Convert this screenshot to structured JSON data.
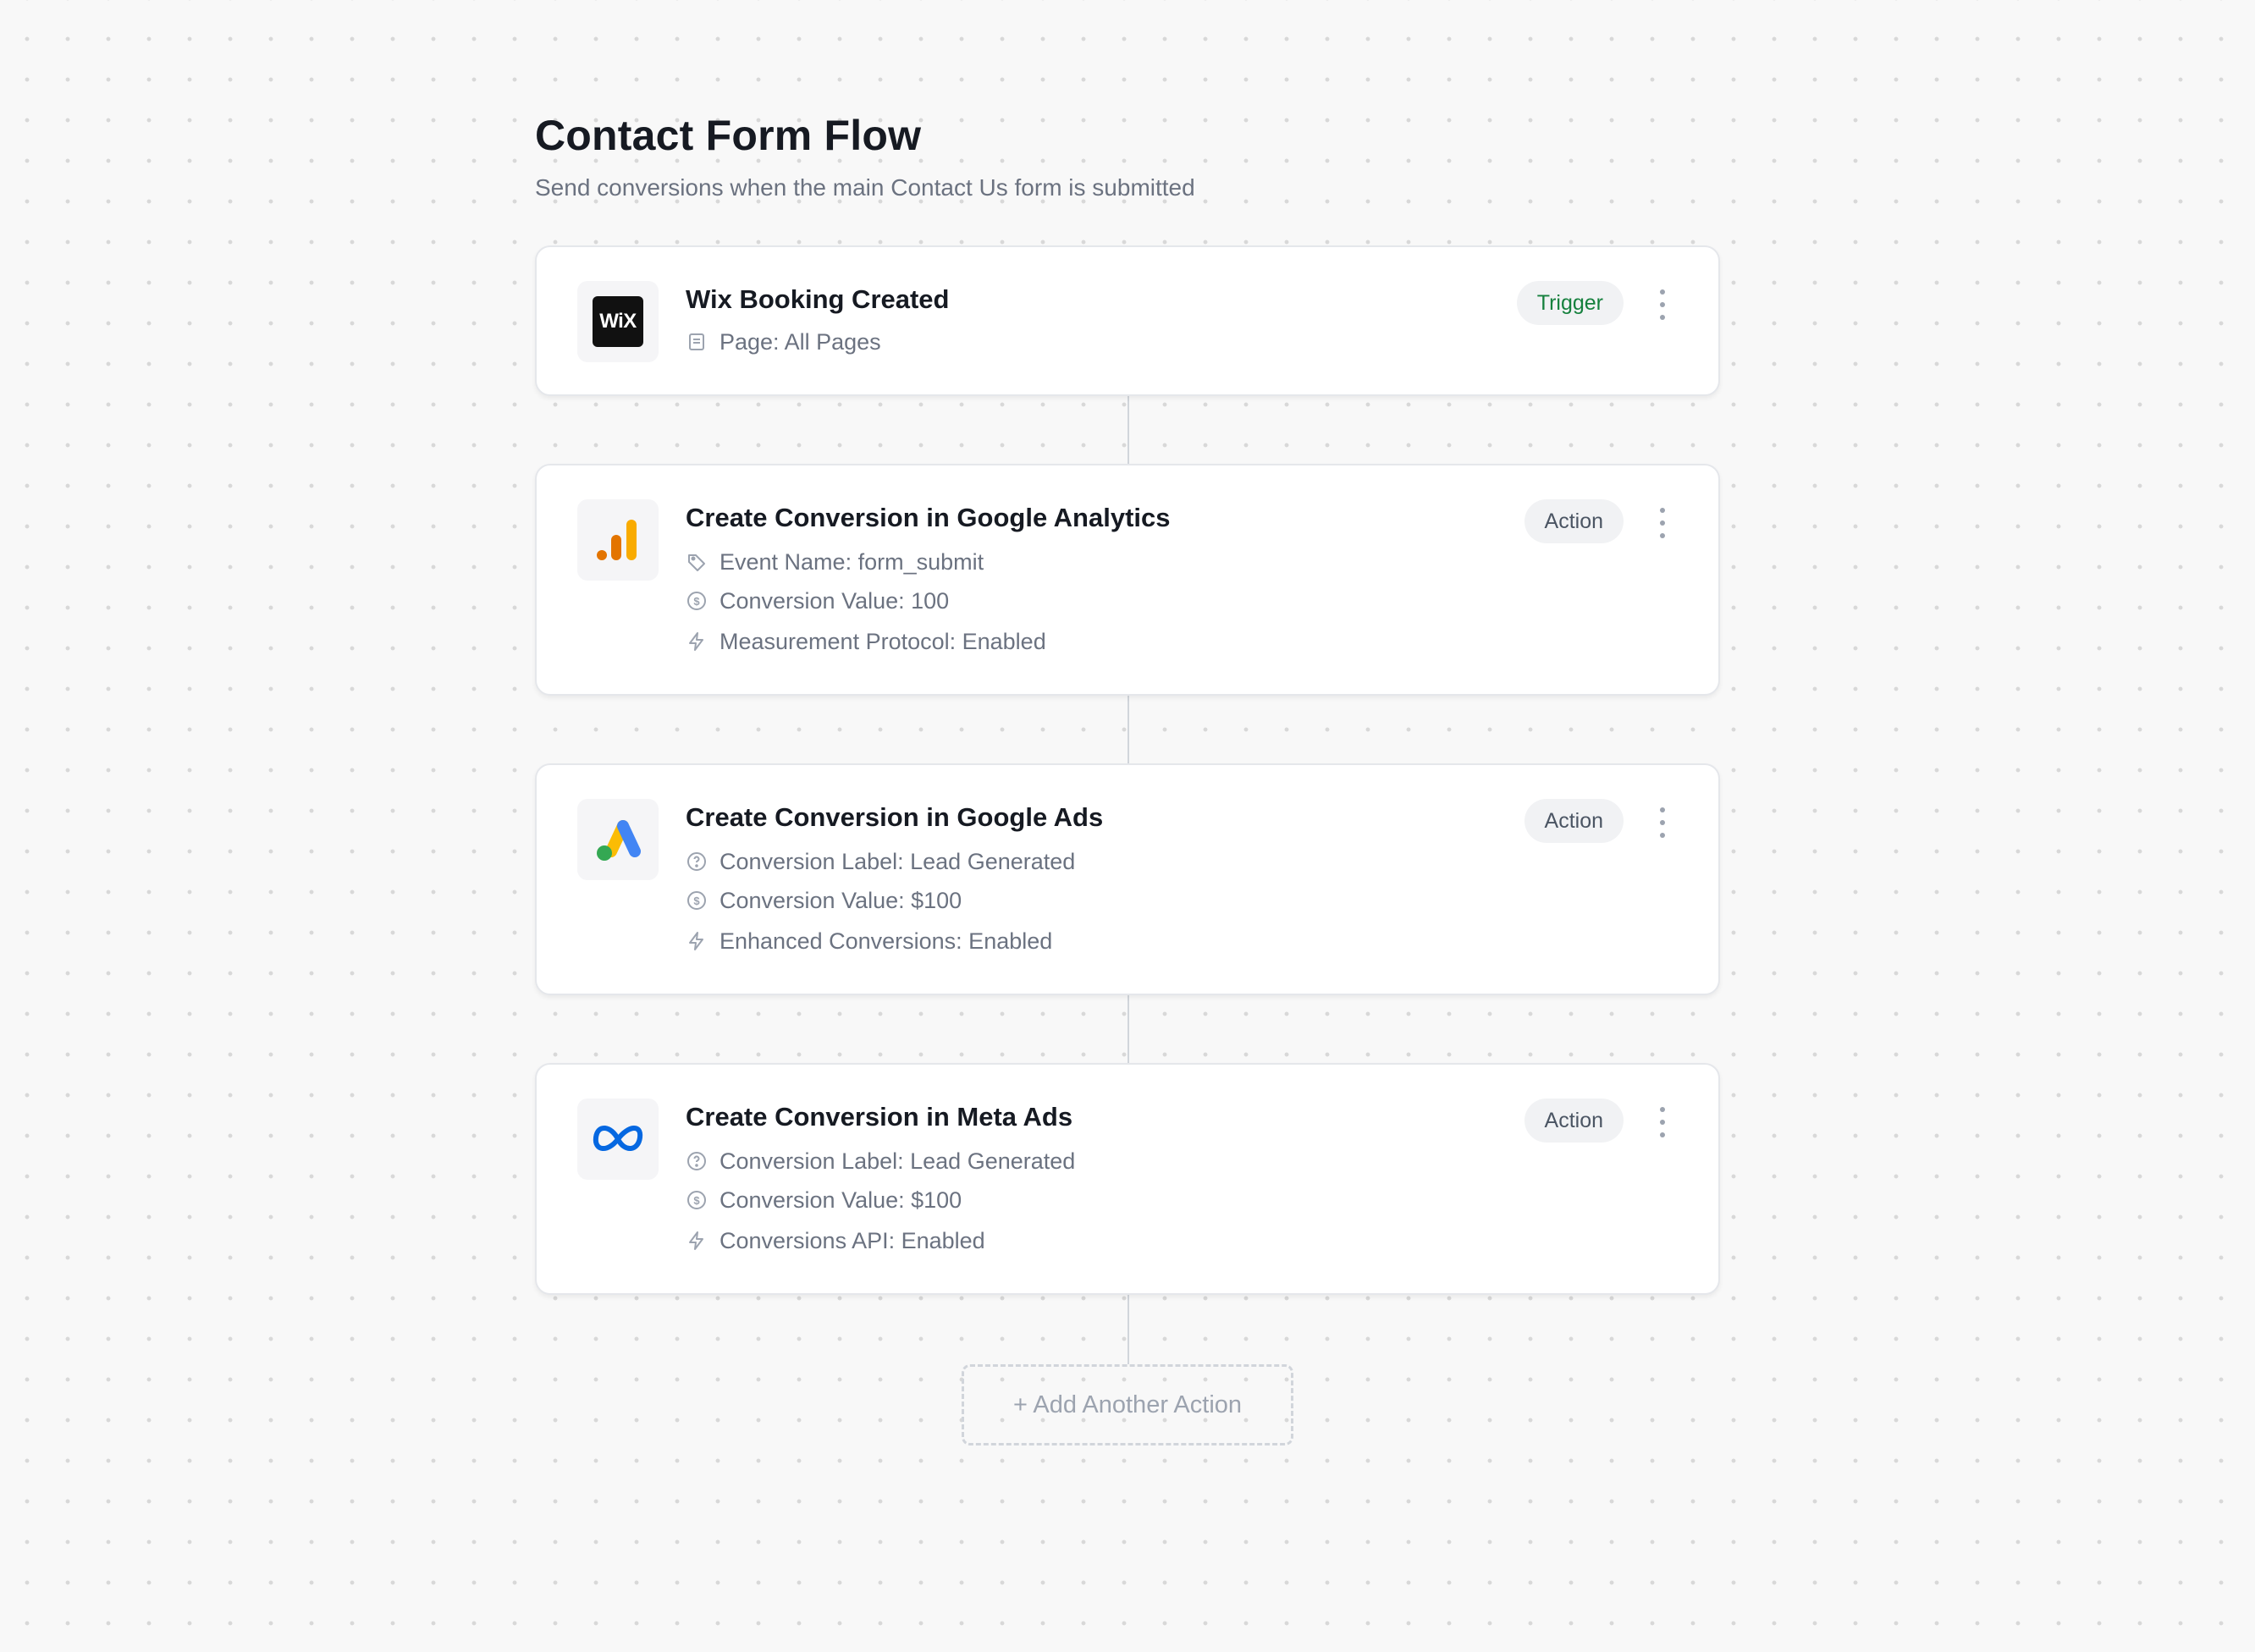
{
  "flow": {
    "title": "Contact Form Flow",
    "subtitle": "Send conversions when the main Contact Us form is submitted"
  },
  "colors": {
    "trigger_text": "#15803d",
    "badge_bg": "#f1f2f4",
    "meta_blue": "#0668e1",
    "ga_orange": "#e37400",
    "ga_yellow": "#f9ab00",
    "gads_blue": "#4285f4",
    "gads_yellow": "#fbbc04",
    "gads_green": "#34a853"
  },
  "steps": [
    {
      "app_icon": "wix-logo",
      "logo_text": "WiX",
      "title": "Wix Booking Created",
      "badge": "Trigger",
      "details": [
        {
          "icon": "page-icon",
          "text": "Page: All Pages"
        }
      ]
    },
    {
      "app_icon": "google-analytics-logo",
      "title": "Create Conversion in Google Analytics",
      "badge": "Action",
      "details": [
        {
          "icon": "tag-icon",
          "text": "Event Name: form_submit"
        },
        {
          "icon": "dollar-icon",
          "text": "Conversion Value: 100"
        },
        {
          "icon": "lightning-icon",
          "text": "Measurement Protocol: Enabled"
        }
      ]
    },
    {
      "app_icon": "google-ads-logo",
      "title": "Create Conversion in Google Ads",
      "badge": "Action",
      "details": [
        {
          "icon": "help-circle-icon",
          "text": "Conversion Label: Lead Generated"
        },
        {
          "icon": "dollar-icon",
          "text": "Conversion Value: $100"
        },
        {
          "icon": "lightning-icon",
          "text": "Enhanced Conversions: Enabled"
        }
      ]
    },
    {
      "app_icon": "meta-logo",
      "title": "Create Conversion in Meta Ads",
      "badge": "Action",
      "details": [
        {
          "icon": "help-circle-icon",
          "text": "Conversion Label: Lead Generated"
        },
        {
          "icon": "dollar-icon",
          "text": "Conversion Value: $100"
        },
        {
          "icon": "lightning-icon",
          "text": "Conversions API: Enabled"
        }
      ]
    }
  ],
  "add_action_label": "+ Add Another Action"
}
